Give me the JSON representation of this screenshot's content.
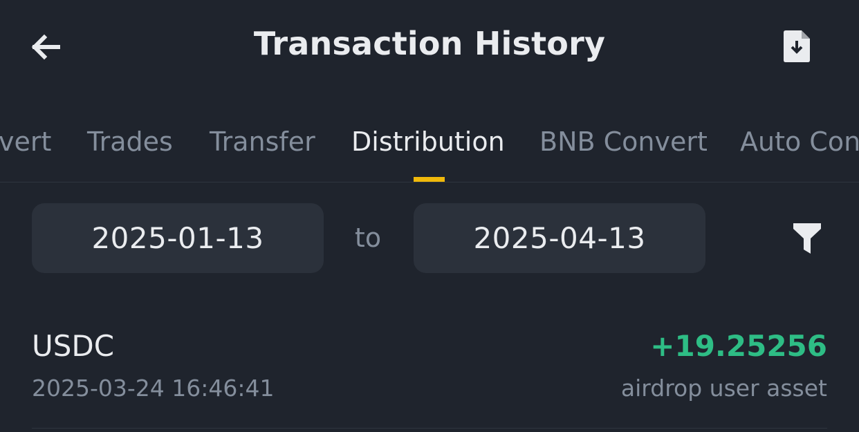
{
  "header": {
    "title": "Transaction History",
    "back_icon": "arrow-left-icon",
    "export_icon": "file-download-icon"
  },
  "tabs": [
    {
      "label": "Convert",
      "visible_text": "vert",
      "active": false
    },
    {
      "label": "Trades",
      "active": false
    },
    {
      "label": "Transfer",
      "active": false
    },
    {
      "label": "Distribution",
      "active": true
    },
    {
      "label": "BNB Convert",
      "active": false
    },
    {
      "label": "Auto Convert",
      "visible_text": "Auto Con",
      "active": false
    }
  ],
  "date_range": {
    "from": "2025-01-13",
    "separator": "to",
    "to": "2025-04-13",
    "filter_icon": "filter-icon"
  },
  "records": [
    {
      "asset": "USDC",
      "time": "2025-03-24 16:46:41",
      "amount": "+19.25256",
      "type": "airdrop user asset"
    }
  ],
  "colors": {
    "background": "#1f242d",
    "field_background": "#2b313b",
    "text_primary": "#eaecef",
    "text_secondary": "#848e9c",
    "accent": "#f0b90b",
    "positive": "#2ebd85"
  }
}
